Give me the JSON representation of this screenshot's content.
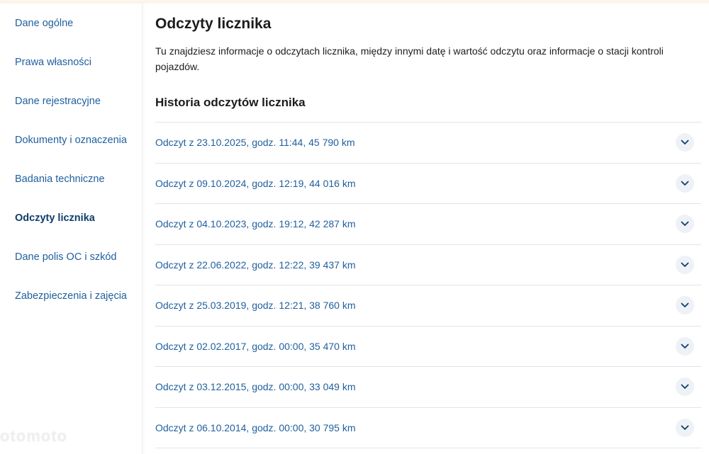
{
  "sidebar": {
    "items": [
      {
        "label": "Dane ogólne",
        "active": false
      },
      {
        "label": "Prawa własności",
        "active": false
      },
      {
        "label": "Dane rejestracyjne",
        "active": false
      },
      {
        "label": "Dokumenty i oznaczenia",
        "active": false
      },
      {
        "label": "Badania techniczne",
        "active": false
      },
      {
        "label": "Odczyty licznika",
        "active": true
      },
      {
        "label": "Dane polis OC i szkód",
        "active": false
      },
      {
        "label": "Zabezpieczenia i zajęcia",
        "active": false
      }
    ]
  },
  "main": {
    "title": "Odczyty licznika",
    "description": "Tu znajdziesz informacje o odczytach licznika, między innymi datę i wartość odczytu oraz informacje o stacji kontroli pojazdów.",
    "section_title": "Historia odczytów licznika",
    "readings": [
      {
        "label": "Odczyt z 23.10.2025, godz. 11:44, 45 790 km"
      },
      {
        "label": "Odczyt z 09.10.2024, godz. 12:19, 44 016 km"
      },
      {
        "label": "Odczyt z 04.10.2023, godz. 19:12, 42 287 km"
      },
      {
        "label": "Odczyt z 22.06.2022, godz. 12:22, 39 437 km"
      },
      {
        "label": "Odczyt z 25.03.2019, godz. 12:21, 38 760 km"
      },
      {
        "label": "Odczyt z 02.02.2017, godz. 00:00, 35 470 km"
      },
      {
        "label": "Odczyt z 03.12.2015, godz. 00:00, 33 049 km"
      },
      {
        "label": "Odczyt z 06.10.2014, godz. 00:00, 30 795 km"
      }
    ]
  },
  "watermark": "otomoto",
  "colors": {
    "link": "#1f5f9e",
    "active": "#0f3d6b",
    "text": "#1c1c1c",
    "divider": "#dfe4ea",
    "chevron_bg": "#eef2f6"
  },
  "icons": {
    "row_toggle": "chevron-down-icon"
  }
}
